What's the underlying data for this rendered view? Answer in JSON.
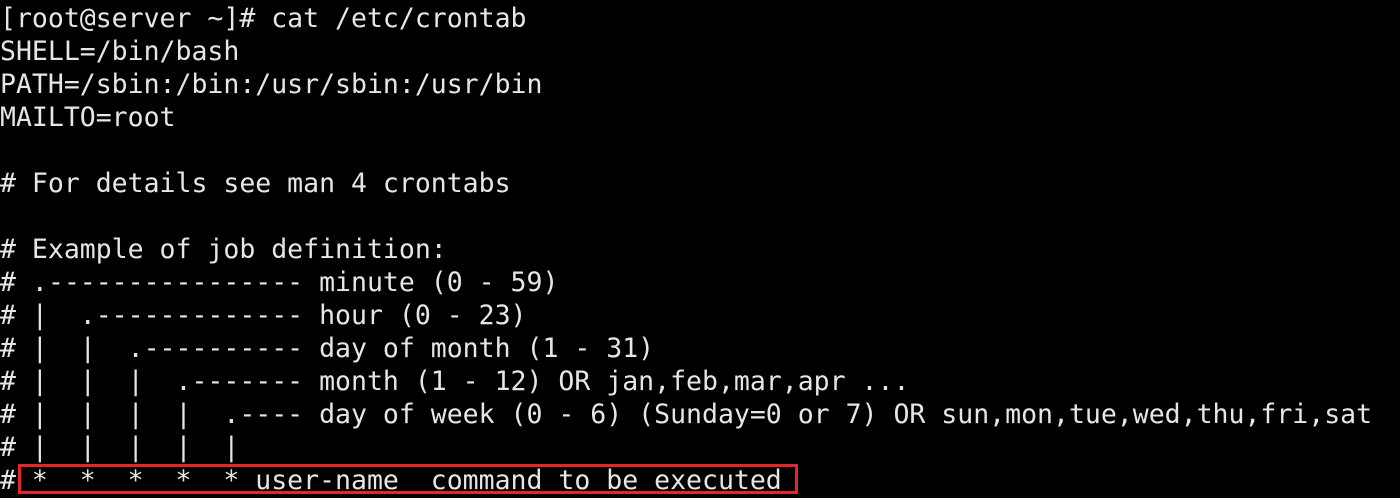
{
  "terminal": {
    "lines": [
      "[root@server ~]# cat /etc/crontab",
      "SHELL=/bin/bash",
      "PATH=/sbin:/bin:/usr/sbin:/usr/bin",
      "MAILTO=root",
      "",
      "# For details see man 4 crontabs",
      "",
      "# Example of job definition:",
      "# .---------------- minute (0 - 59)",
      "# |  .------------- hour (0 - 23)",
      "# |  |  .---------- day of month (1 - 31)",
      "# |  |  |  .------- month (1 - 12) OR jan,feb,mar,apr ...",
      "# |  |  |  |  .---- day of week (0 - 6) (Sunday=0 or 7) OR sun,mon,tue,wed,thu,fri,sat",
      "# |  |  |  |  |",
      "# *  *  *  *  * user-name  command to be executed"
    ]
  },
  "colors": {
    "background": "#000000",
    "text": "#e6e6e6",
    "highlight": "#e32626"
  }
}
